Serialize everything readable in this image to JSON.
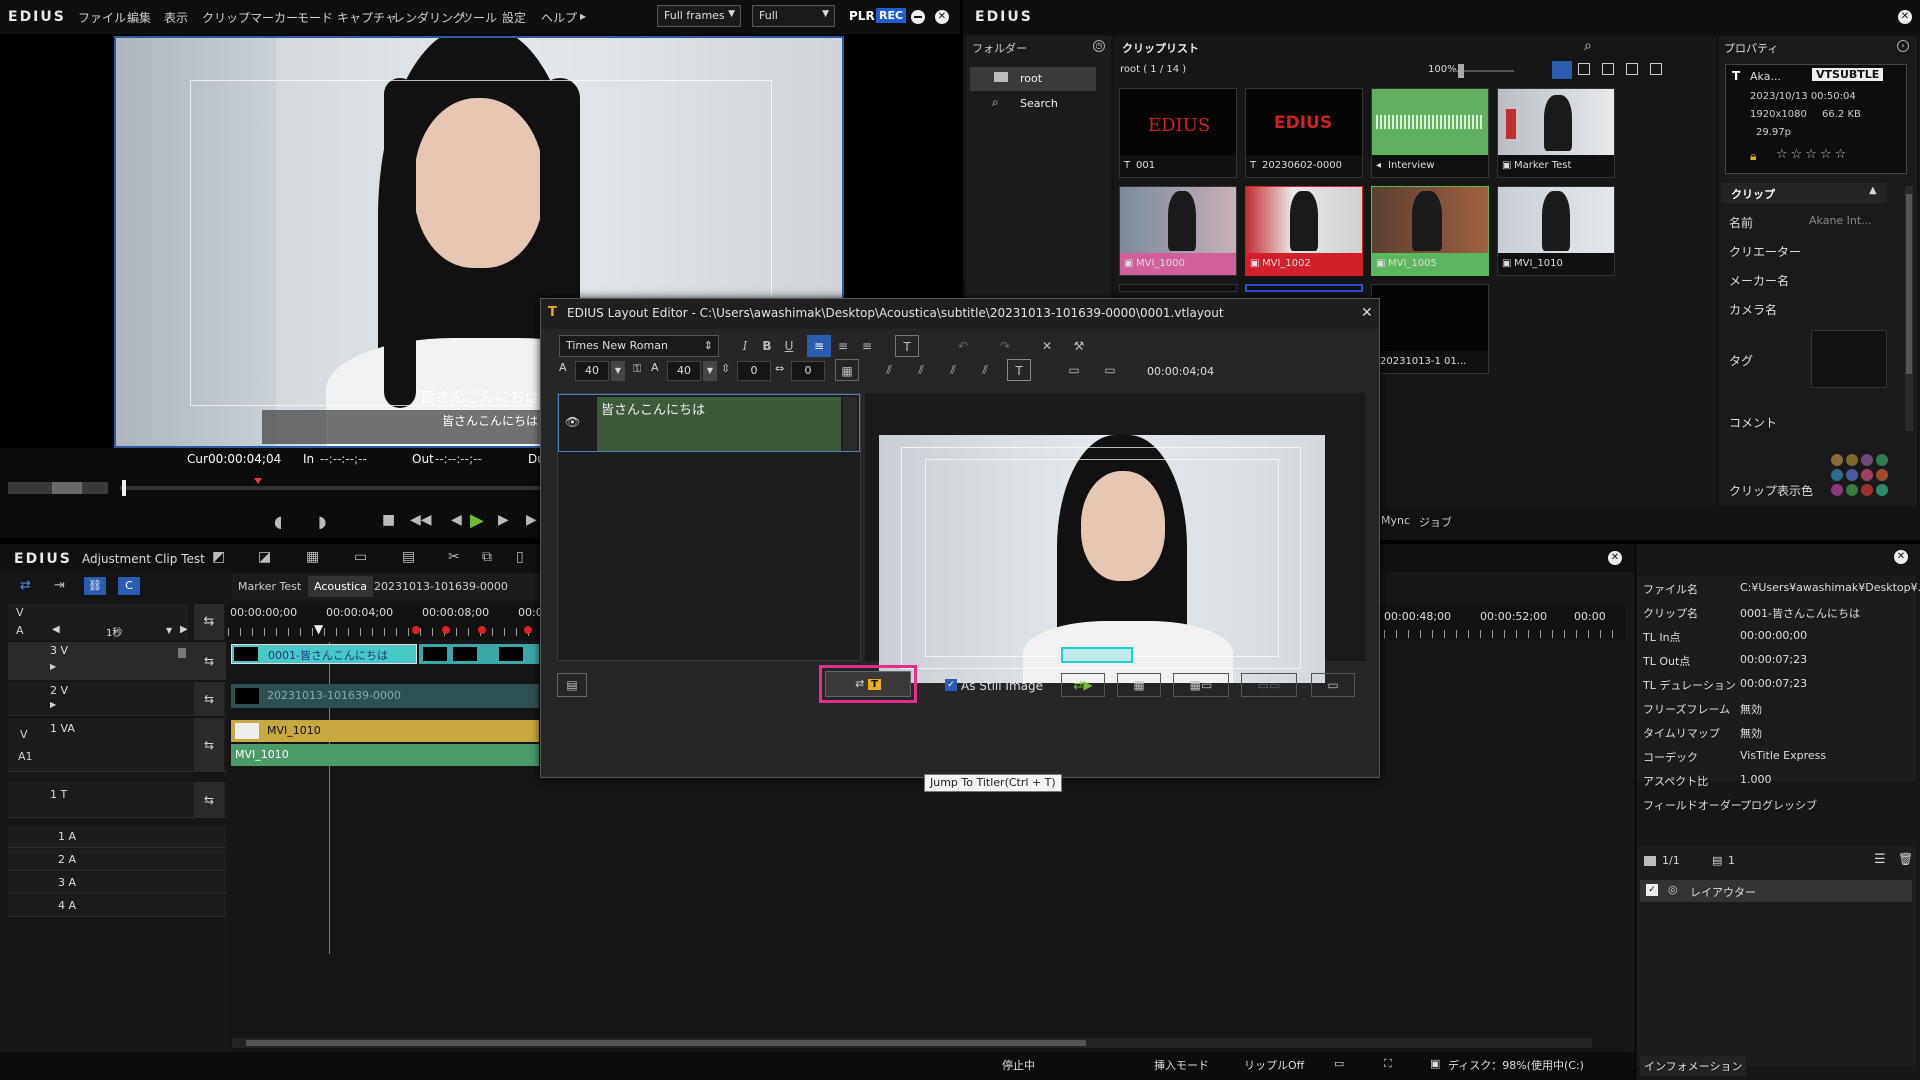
{
  "player": {
    "logo": "EDIUS",
    "menu": [
      "ファイル",
      "編集",
      "表示",
      "クリップ",
      "マーカー",
      "モード",
      "キャプチャ",
      "レンダリング",
      "ツール",
      "設定",
      "ヘルプ"
    ],
    "menu_more": "▸",
    "frames_combo": "Full frames",
    "quality_combo": "Full",
    "plr_label": "PLR",
    "rec_label": "REC",
    "subtitle_line1": "皆さんこんにちは",
    "subtitle_line2": "皆さんこんにちは",
    "cur_label": "Cur",
    "cur_value": "00:00:04;04",
    "in_label": "In",
    "in_value": "--:--:--;--",
    "out_label": "Out",
    "out_value": "--:--:--;--",
    "dur_label": "Du"
  },
  "bin": {
    "logo": "EDIUS",
    "folder_header": "フォルダー",
    "folders": [
      "root",
      "Search"
    ],
    "cliplist_header": "クリップリスト",
    "path": "root ( 1 / 14 )",
    "zoom": "100%",
    "clips": [
      {
        "label": "001",
        "kind": "title",
        "text": "EDIUS",
        "accent": "#101010"
      },
      {
        "label": "20230602-0000",
        "kind": "title",
        "text": "EDIUS",
        "accent": "#101010"
      },
      {
        "label": "Interview",
        "kind": "audio",
        "text": "",
        "accent": "#101010"
      },
      {
        "label": "Marker Test",
        "kind": "video",
        "text": "",
        "accent": "#101010"
      },
      {
        "label": "MVI_1000",
        "kind": "video",
        "text": "",
        "accent": "#d0609a"
      },
      {
        "label": "MVI_1002",
        "kind": "video",
        "text": "",
        "accent": "#d2202a"
      },
      {
        "label": "MVI_1005",
        "kind": "video",
        "text": "",
        "accent": "#5cb85c"
      },
      {
        "label": "MVI_1010",
        "kind": "video",
        "text": "",
        "accent": "#101010"
      }
    ],
    "extra_clip_label": "20231013-1 01...",
    "bottom_tabs": [
      "Mync",
      "ジョブ"
    ]
  },
  "properties": {
    "header": "プロパティ",
    "clip_name_short": "Aka...",
    "badge": "VTSUBTLE",
    "date": "2023/10/13 00:50:04",
    "resolution": "1920x1080",
    "size": "66.2 KB",
    "fps": "29.97p",
    "clip_section": "クリップ",
    "fields": [
      {
        "label": "名前",
        "value": "Akane Int..."
      },
      {
        "label": "クリエーター",
        "value": ""
      },
      {
        "label": "メーカー名",
        "value": ""
      },
      {
        "label": "カメラ名",
        "value": ""
      },
      {
        "label": "タグ",
        "value": ""
      },
      {
        "label": "コメント",
        "value": ""
      },
      {
        "label": "クリップ表示色",
        "value": ""
      }
    ],
    "swatch_colors": [
      "#8a6b3a",
      "#7a6a2a",
      "#6d4a7a",
      "#2f7a4f",
      "#2f6a8a",
      "#4a5aa0",
      "#a04060",
      "#a04a2a",
      "#8a3a7a",
      "#3a7a3a",
      "#a03030",
      "#2a8a6a"
    ]
  },
  "timeline": {
    "logo": "EDIUS",
    "project_name": "Adjustment Clip Test",
    "tabs": [
      "Marker Test",
      "Acoustica",
      "20231013-101639-0000"
    ],
    "scale": "1秒",
    "ruler": [
      "00:00:00;00",
      "00:00:04;00",
      "00:00:08;00",
      "00:0"
    ],
    "ruler_right": [
      "00:00:48;00",
      "00:00:52;00",
      "00:00"
    ],
    "tracks": [
      {
        "name": "3 V",
        "clip": "0001-皆さんこんにちは"
      },
      {
        "name": "2 V",
        "clip": "20231013-101639-0000"
      },
      {
        "name": "1 VA",
        "clip": "MVI_1010",
        "audio_clip": "MVI_1010"
      },
      {
        "name": "1 T",
        "clip": ""
      },
      {
        "name": "1 A",
        "clip": ""
      },
      {
        "name": "2 A",
        "clip": ""
      },
      {
        "name": "3 A",
        "clip": ""
      },
      {
        "name": "4 A",
        "clip": ""
      }
    ],
    "va_labels": [
      "V",
      "A"
    ],
    "v_label": "V",
    "a_label": "A1"
  },
  "info_panel": {
    "rows": [
      {
        "label": "ファイル名",
        "value": "C:¥Users¥awashimak¥Desktop¥..."
      },
      {
        "label": "クリップ名",
        "value": "0001-皆さんこんにちは"
      },
      {
        "label": "TL In点",
        "value": "00:00:00;00"
      },
      {
        "label": "TL Out点",
        "value": "00:00:07;23"
      },
      {
        "label": "TL デュレーション",
        "value": "00:00:07;23"
      },
      {
        "label": "フリーズフレーム",
        "value": "無効"
      },
      {
        "label": "タイムリマップ",
        "value": "無効"
      },
      {
        "label": "コーデック",
        "value": "VisTitle Express"
      },
      {
        "label": "アスペクト比",
        "value": "1.000"
      },
      {
        "label": "フィールドオーダー",
        "value": "プログレッシブ"
      }
    ],
    "count": "1/1",
    "layer_count": "1",
    "layer_item": "レイアウター",
    "tab": "インフォメーション"
  },
  "status_bar": {
    "state": "停止中",
    "mode": "挿入モード",
    "ripple": "リップルOff",
    "disk": "ディスク：98%(使用中(C:)"
  },
  "layout_editor": {
    "title": "EDIUS Layout Editor - C:\\Users\\awashimak\\Desktop\\Acoustica\\subtitle\\20231013-101639-0000\\0001.vtlayout",
    "font": "Times New Roman",
    "size1": "40",
    "size2": "40",
    "spacing1": "0",
    "spacing2": "0",
    "timecode": "00:00:04;04",
    "text_content": "皆さんこんにちは",
    "still_label": "As Still Image",
    "tooltip": "Jump To Titler(Ctrl + T)",
    "highlight_color": "#e0308a"
  }
}
